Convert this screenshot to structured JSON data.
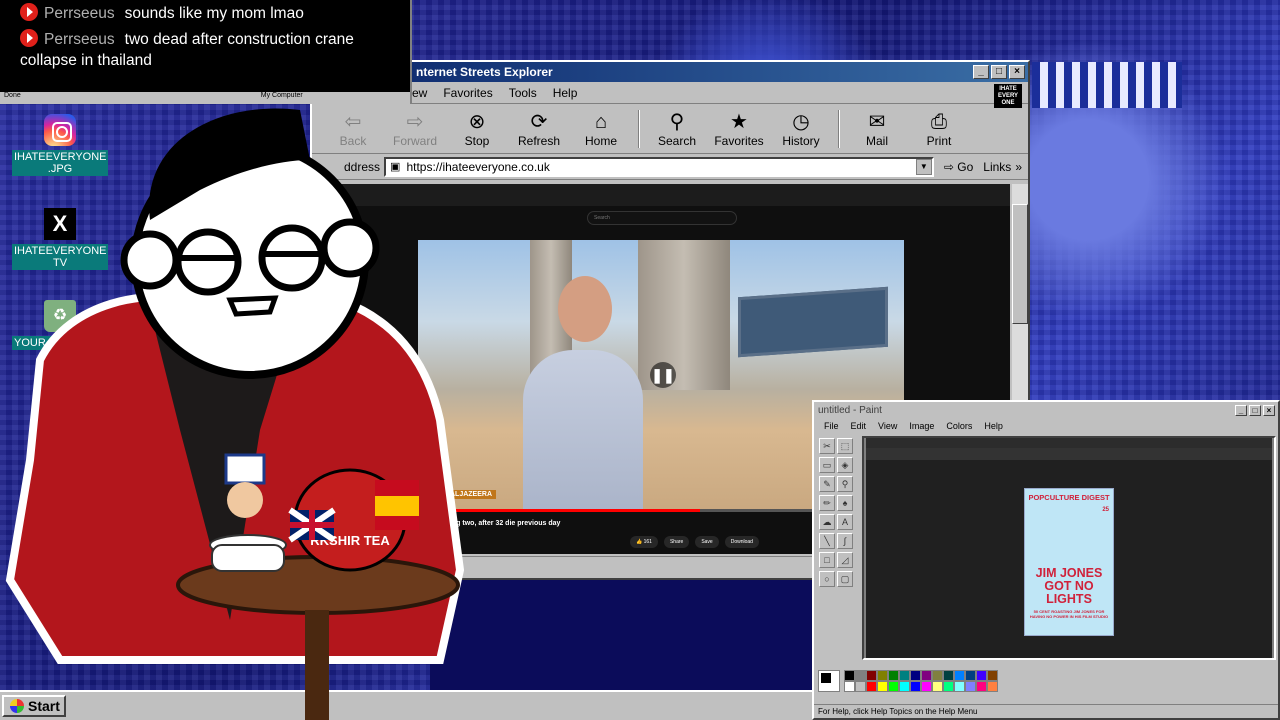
{
  "chat": {
    "messages": [
      {
        "user": "Perrseeus",
        "text": "sounds like my mom lmao"
      },
      {
        "user": "Perrseeus",
        "text": "two dead after construction crane collapse in thailand"
      }
    ],
    "status_left": "Done",
    "status_right": "My Computer"
  },
  "desktop_icons": [
    {
      "label": "IHATEEVERYONE .JPG",
      "icon": "instagram-icon"
    },
    {
      "label": "IHATEEVERYONE TV",
      "icon": "x-icon"
    },
    {
      "label": "YOUR",
      "icon": "recycle-bin-icon"
    }
  ],
  "browser": {
    "title": "nternet Streets Explorer",
    "menu": [
      "ew",
      "Favorites",
      "Tools",
      "Help"
    ],
    "toolbar": [
      {
        "label": "Back",
        "icon": "back-arrow-icon",
        "disabled": true
      },
      {
        "label": "Forward",
        "icon": "forward-arrow-icon",
        "disabled": true
      },
      {
        "label": "Stop",
        "icon": "stop-icon",
        "disabled": false
      },
      {
        "label": "Refresh",
        "icon": "refresh-icon",
        "disabled": false
      },
      {
        "label": "Home",
        "icon": "home-icon",
        "disabled": false
      },
      {
        "label": "Search",
        "icon": "search-icon",
        "disabled": false
      },
      {
        "label": "Favorites",
        "icon": "favorites-icon",
        "disabled": false
      },
      {
        "label": "History",
        "icon": "history-icon",
        "disabled": false
      },
      {
        "label": "Mail",
        "icon": "mail-icon",
        "disabled": false
      },
      {
        "label": "Print",
        "icon": "print-icon",
        "disabled": false
      }
    ],
    "address_label": "ddress",
    "address": "https://ihateeveryone.co.uk",
    "go_label": "Go",
    "links_label": "Links",
    "video": {
      "channel_badge": "ALJAZEERA",
      "caption": "iland, killing two, after 32 die previous day",
      "progress": 0.58,
      "actions": [
        "161",
        "Share",
        "Save",
        "Download"
      ],
      "search_placeholder": "Search"
    }
  },
  "paint": {
    "title": "untitled - Paint",
    "menu": [
      "File",
      "Edit",
      "View",
      "Image",
      "Colors",
      "Help"
    ],
    "status": "For Help, click Help Topics on the Help Menu",
    "magazine": {
      "masthead": "POPCULTURE DIGEST",
      "issue": "25",
      "headline": "JIM JONES GOT NO LIGHTS",
      "footer": "50 CENT ROASTING JIM JONES FOR HAVING NO POWER IN HIS FILM STUDIO"
    },
    "palette": [
      "#000000",
      "#808080",
      "#800000",
      "#808000",
      "#008000",
      "#008080",
      "#000080",
      "#800080",
      "#808040",
      "#004040",
      "#0080ff",
      "#004080",
      "#4000ff",
      "#804000",
      "#ffffff",
      "#c0c0c0",
      "#ff0000",
      "#ffff00",
      "#00ff00",
      "#00ffff",
      "#0000ff",
      "#ff00ff",
      "#ffff80",
      "#00ff80",
      "#80ffff",
      "#8080ff",
      "#ff0080",
      "#ff8040"
    ]
  },
  "taskbar": {
    "start_label": "Start"
  },
  "character": {
    "mug_text": "RKSHIR TEA"
  }
}
